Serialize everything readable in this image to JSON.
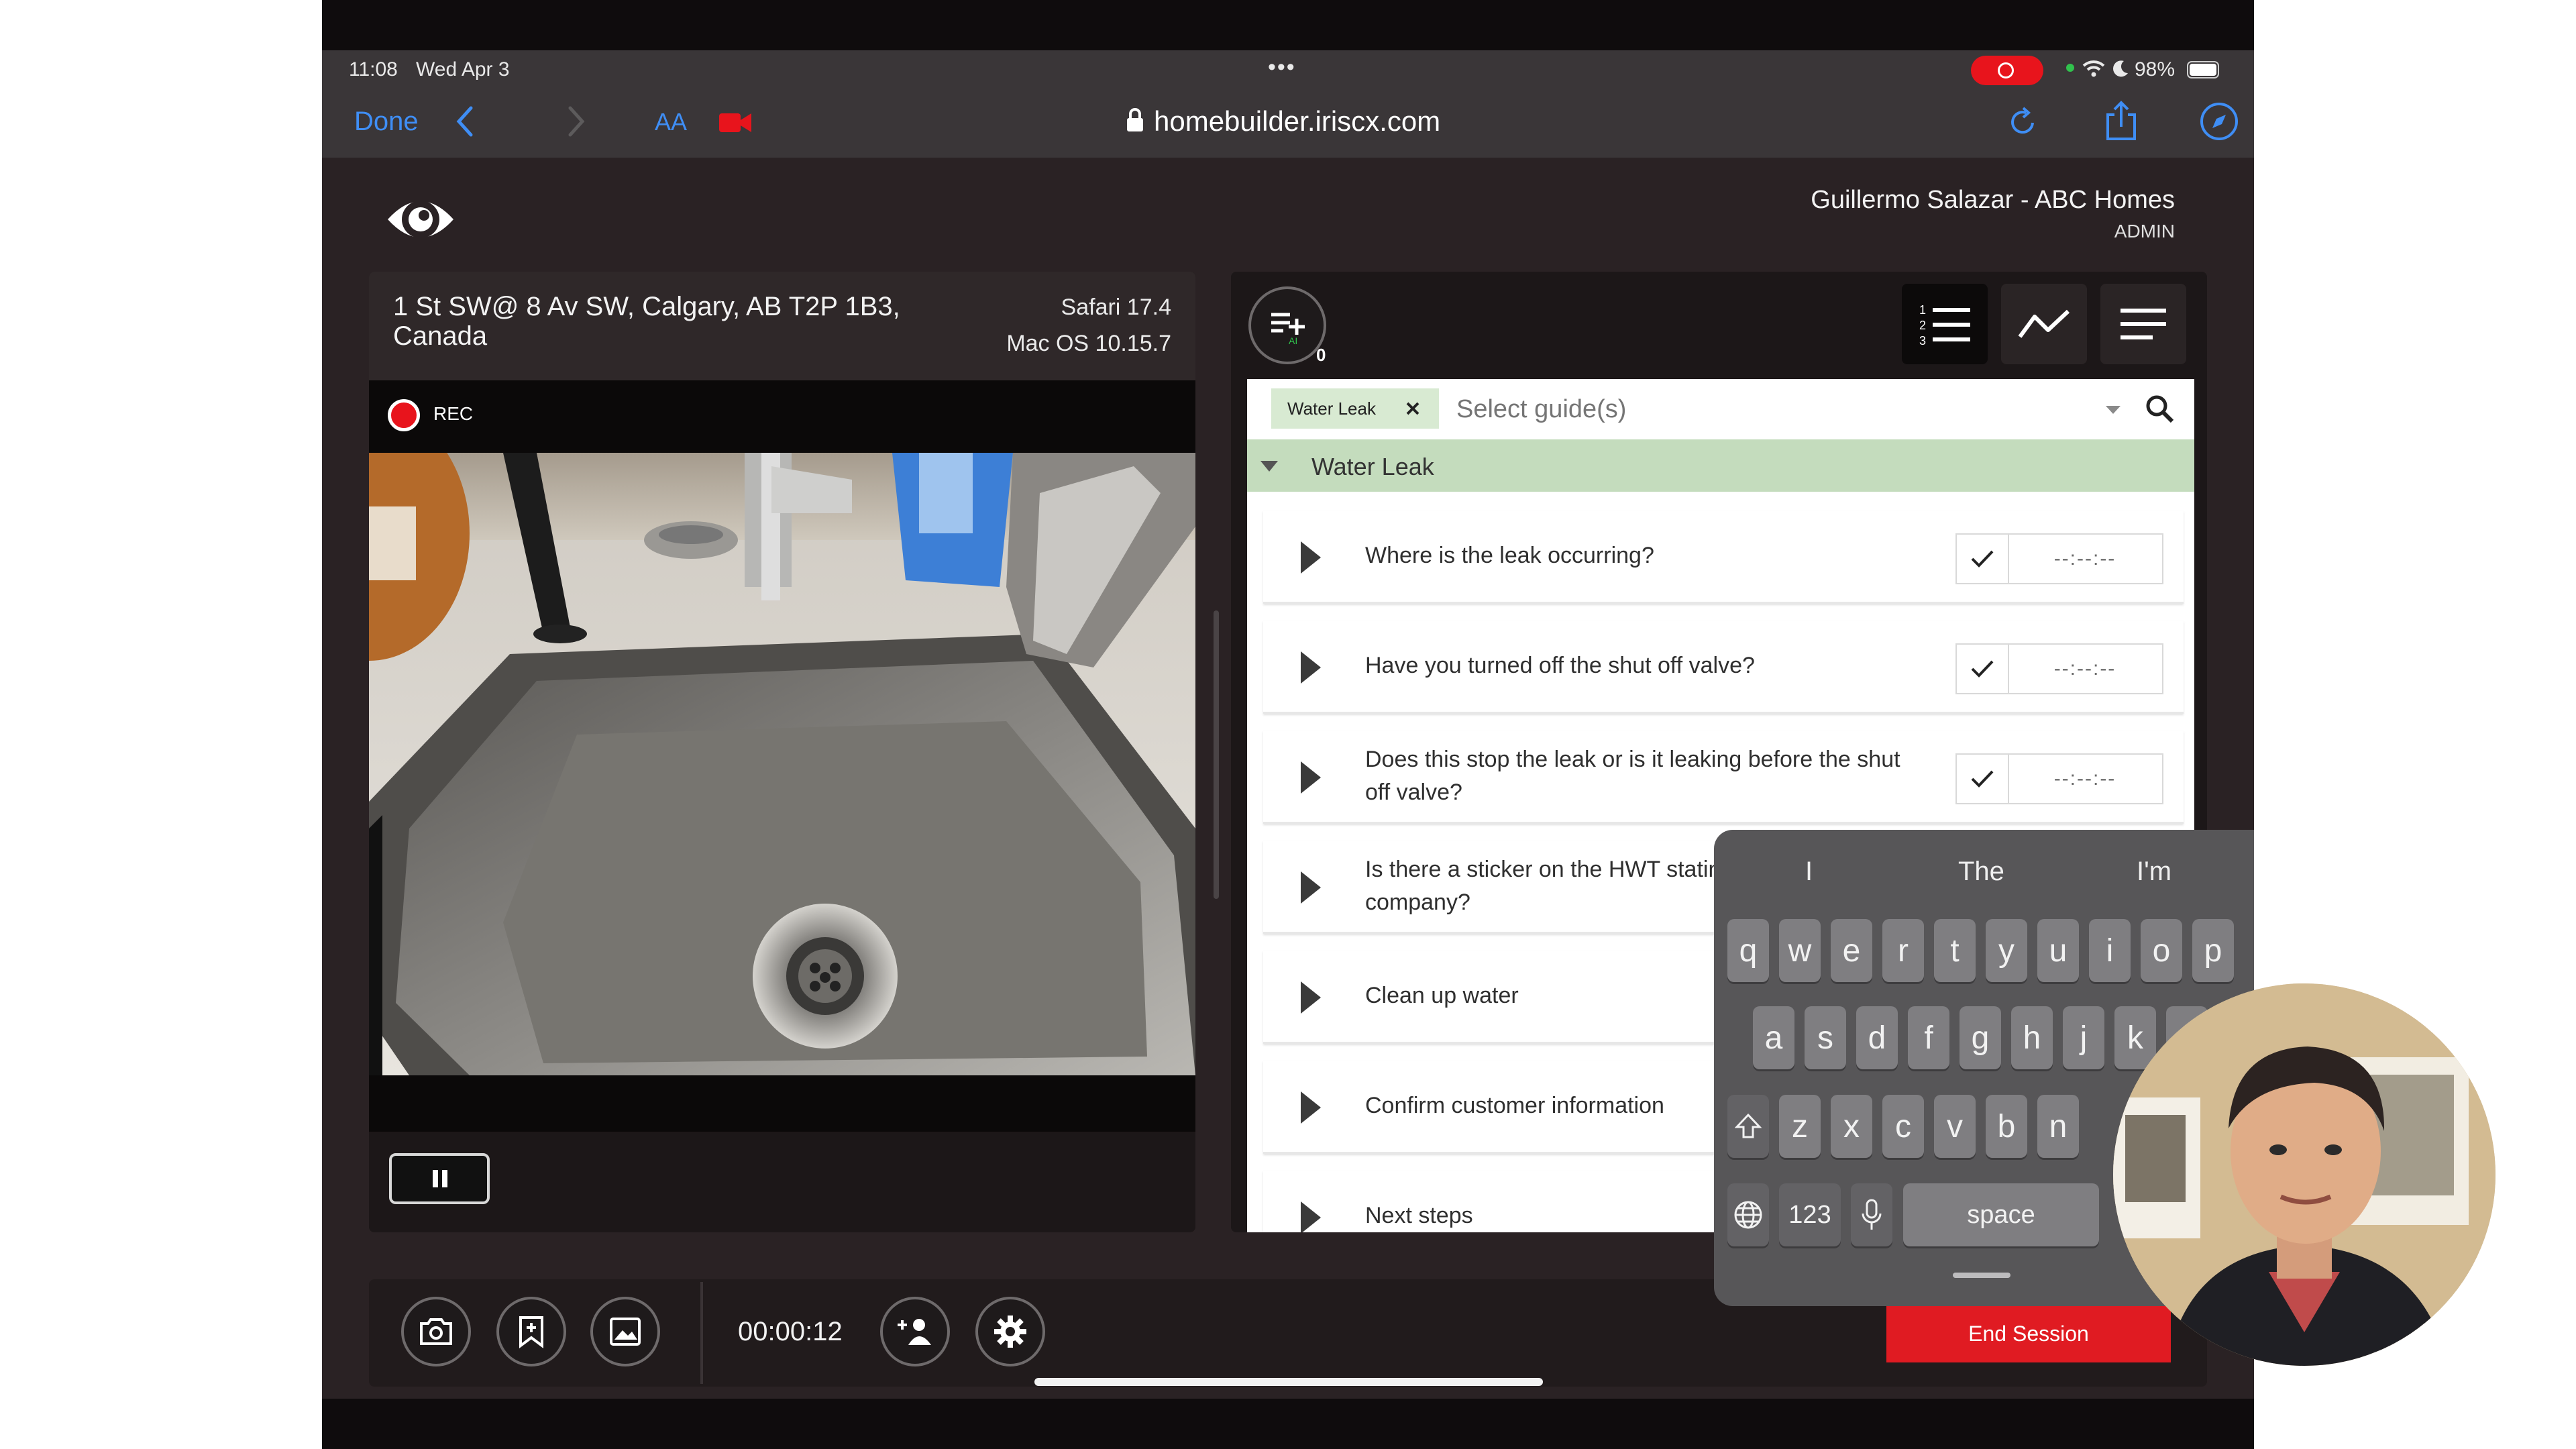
{
  "status_bar": {
    "time": "11:08",
    "date": "Wed Apr 3",
    "battery": "98%",
    "dots": "•••"
  },
  "safari": {
    "done": "Done",
    "text_size": "AA",
    "url": "homebuilder.iriscx.com"
  },
  "header": {
    "user": "Guillermo Salazar - ABC Homes",
    "role": "ADMIN"
  },
  "video": {
    "address": "1 St SW@ 8 Av SW, Calgary, AB T2P 1B3, Canada",
    "browser": "Safari 17.4",
    "os": "Mac OS 10.15.7",
    "rec_label": "REC"
  },
  "guides": {
    "ai_count": "0",
    "tag": "Water Leak",
    "placeholder": "Select guide(s)",
    "section_title": "Water Leak",
    "time_placeholder": "--:--:--",
    "questions": [
      "Where is the leak occurring?",
      "Have you turned off the shut off valve?",
      "Does this stop the leak or is it leaking before the shut off valve?",
      "Is there a sticker on the HWT stating the plumbing company?",
      "Clean up water",
      "Confirm customer information",
      "Next steps"
    ]
  },
  "toolbar": {
    "timer": "00:00:12",
    "end_session": "End Session"
  },
  "keyboard": {
    "suggestions": [
      "I",
      "The",
      "I'm"
    ],
    "row1": [
      "q",
      "w",
      "e",
      "r",
      "t",
      "y",
      "u",
      "i",
      "o",
      "p"
    ],
    "row2": [
      "a",
      "s",
      "d",
      "f",
      "g",
      "h",
      "j",
      "k"
    ],
    "row3": [
      "z",
      "x",
      "c",
      "v",
      "b",
      "n"
    ],
    "numbers_key": "123",
    "space_key": "space"
  },
  "colors": {
    "accent_blue": "#3f8ef5",
    "record_red": "#e8141c",
    "section_green": "#c4dcbd",
    "end_session_red": "#e01b22"
  }
}
